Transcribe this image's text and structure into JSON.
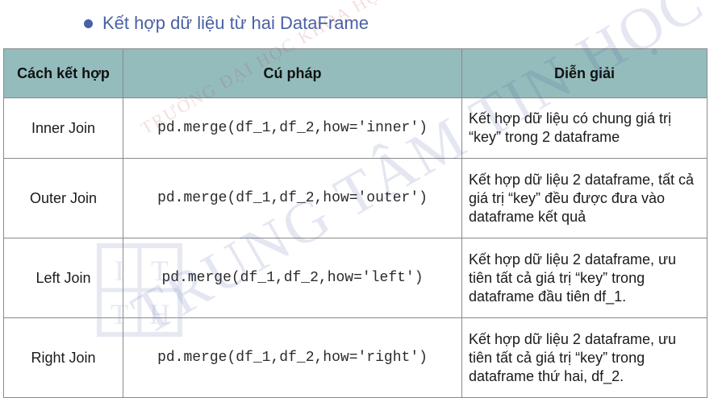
{
  "heading": {
    "text": "Kết hợp dữ liệu từ hai DataFrame"
  },
  "table": {
    "headers": [
      "Cách kết hợp",
      "Cú pháp",
      "Diễn giải"
    ],
    "rows": [
      {
        "method": "Inner Join",
        "syntax": "pd.merge(df_1,df_2,how='inner')",
        "desc": "Kết hợp dữ liệu có chung giá trị “key” trong 2 dataframe"
      },
      {
        "method": "Outer Join",
        "syntax": "pd.merge(df_1,df_2,how='outer')",
        "desc": "Kết hợp dữ liệu 2 dataframe, tất cả giá trị “key” đều được đưa vào dataframe kết quả"
      },
      {
        "method": "Left Join",
        "syntax": "pd.merge(df_1,df_2,how='left')",
        "desc": "Kết hợp dữ liệu 2 dataframe, ưu tiên tất cả giá trị “key” trong dataframe đầu tiên df_1."
      },
      {
        "method": "Right Join",
        "syntax": "pd.merge(df_1,df_2,how='right')",
        "desc": "Kết hợp dữ liệu 2 dataframe, ưu tiên tất cả giá trị “key” trong dataframe thứ hai, df_2."
      }
    ]
  },
  "watermark": {
    "line1": "TRƯỜNG ĐẠI HỌC KHOA HỌC TỰ NHIÊN",
    "line2": "TRUNG TÂM TIN HỌC",
    "colors": {
      "red": "#b23a3a",
      "blue": "#3a4f9a"
    }
  },
  "colors": {
    "heading": "#4a5fa6",
    "header_bg": "#94bcbc",
    "border": "#8a8a8a"
  }
}
